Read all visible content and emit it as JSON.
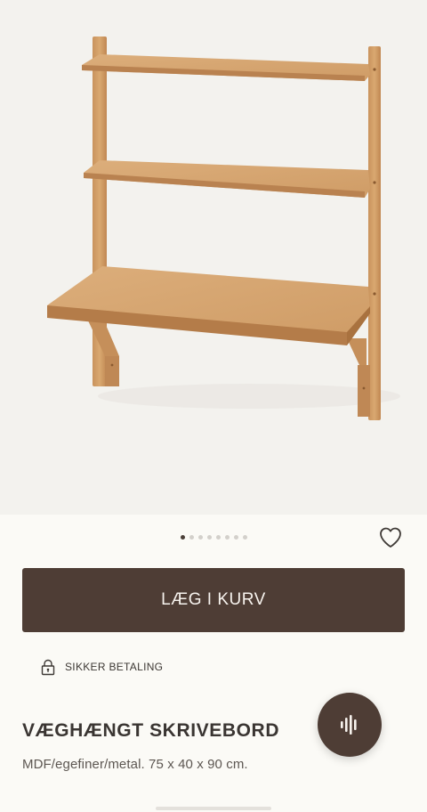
{
  "product": {
    "image_alt": "Wall-mounted oak desk with two shelves",
    "title": "VÆGHÆNGT SKRIVEBORD",
    "description": "MDF/egefiner/metal. 75 x 40 x 90 cm."
  },
  "gallery": {
    "total_images": 8,
    "active_index": 0
  },
  "actions": {
    "add_to_cart_label": "LÆG I KURV",
    "secure_payment_label": "SIKKER BETALING"
  },
  "icons": {
    "favorite": "heart-outline-icon",
    "lock": "lock-icon",
    "voice": "voice-wave-icon"
  },
  "colors": {
    "brand_brown": "#4e3d35",
    "background": "#fbfaf6",
    "hero_background": "#f3f2ee",
    "wood": "#d6a672"
  }
}
